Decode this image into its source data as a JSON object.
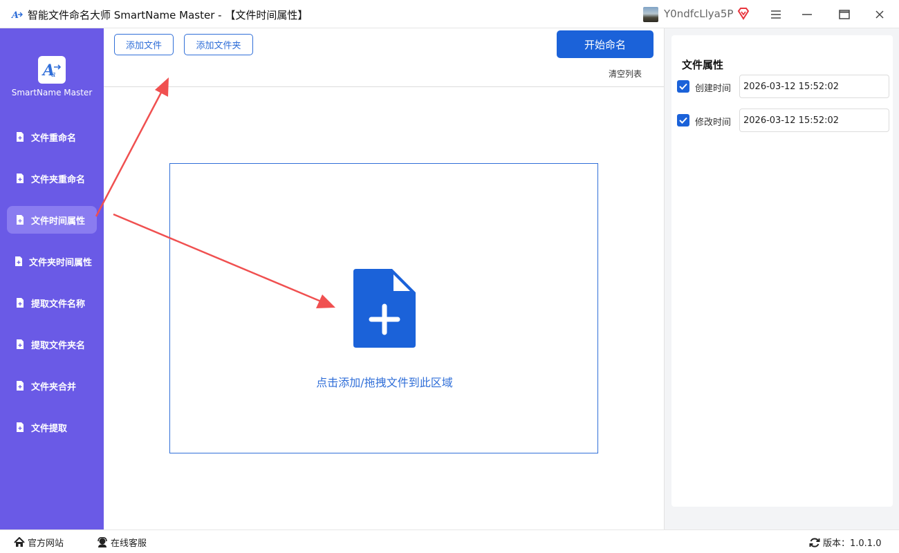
{
  "window": {
    "title": "智能文件命名大师 SmartName Master - 【文件时间属性】",
    "username": "Y0ndfcLlya5P",
    "menu_icon": "hamburger-menu-icon",
    "minimize_icon": "minimize-icon",
    "maximize_icon": "maximize-icon",
    "close_icon": "close-icon"
  },
  "sidebar": {
    "brand": "SmartName Master",
    "items": [
      {
        "label": "文件重命名",
        "icon": "file-plus-icon",
        "active": false
      },
      {
        "label": "文件夹重命名",
        "icon": "file-plus-icon",
        "active": false
      },
      {
        "label": "文件时间属性",
        "icon": "file-plus-icon",
        "active": true
      },
      {
        "label": "文件夹时间属性",
        "icon": "file-plus-icon",
        "active": false
      },
      {
        "label": "提取文件名称",
        "icon": "file-plus-icon",
        "active": false
      },
      {
        "label": "提取文件夹名",
        "icon": "file-plus-icon",
        "active": false
      },
      {
        "label": "文件夹合并",
        "icon": "file-plus-icon",
        "active": false
      },
      {
        "label": "文件提取",
        "icon": "file-plus-icon",
        "active": false
      }
    ]
  },
  "toolbar": {
    "add_file": "添加文件",
    "add_folder": "添加文件夹",
    "start": "开始命名",
    "clear_list": "清空列表"
  },
  "dropzone": {
    "hint": "点击添加/拖拽文件到此区域",
    "icon": "file-add-icon"
  },
  "properties": {
    "title": "文件属性",
    "created": {
      "label": "创建时间",
      "value": "2026-03-12 15:52:02",
      "checked": true
    },
    "modified": {
      "label": "修改时间",
      "value": "2026-03-12 15:52:02",
      "checked": true
    }
  },
  "footer": {
    "website": "官方网站",
    "support": "在线客服",
    "version": "版本：1.0.1.0"
  },
  "colors": {
    "sidebar": "#6a5ae6",
    "sidebar_active": "#8a7cf0",
    "primary": "#1b62d9",
    "accent_text": "#2f6ed8",
    "annotation_arrow": "#f05050"
  }
}
